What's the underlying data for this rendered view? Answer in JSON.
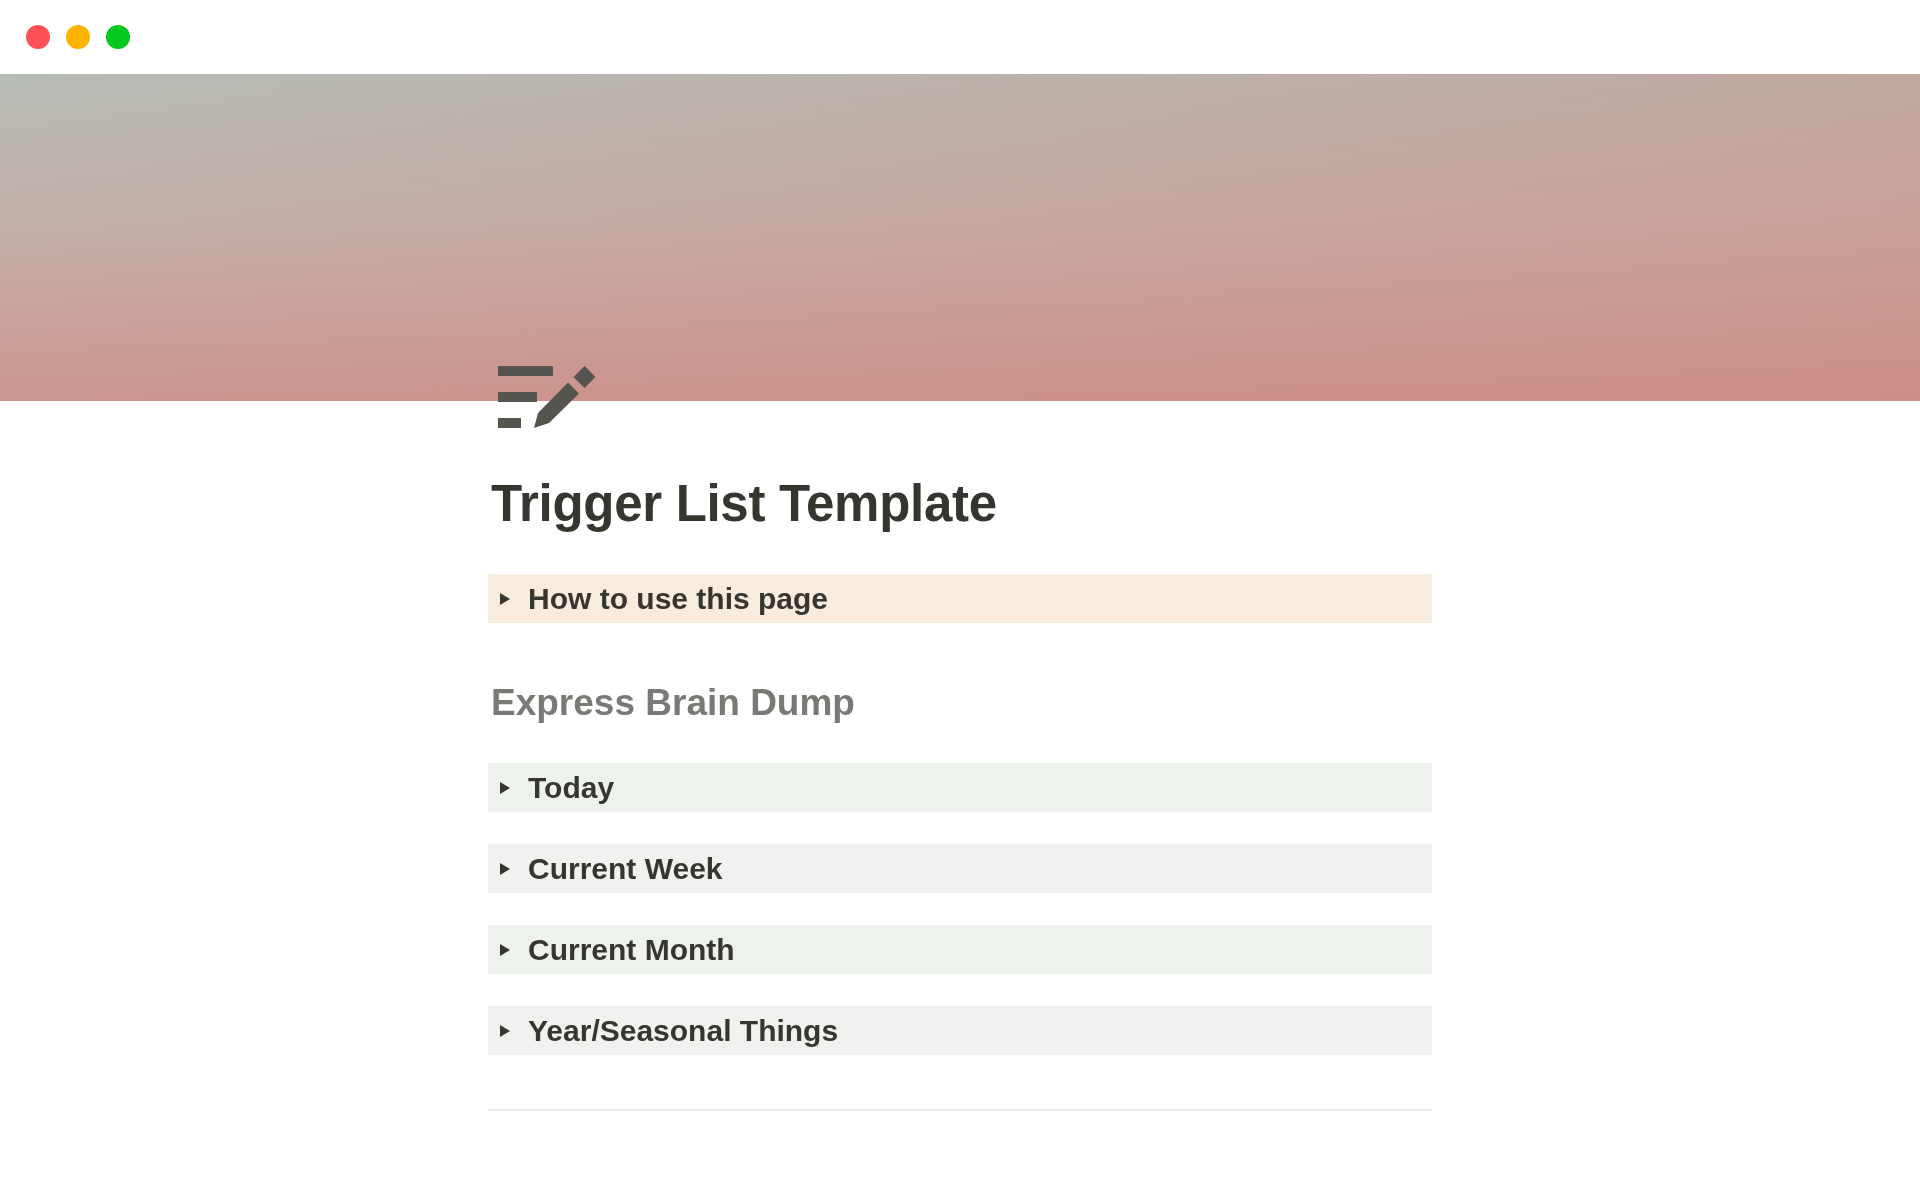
{
  "page": {
    "title": "Trigger List Template",
    "blocks": [
      {
        "kind": "toggle",
        "label": "How to use this page",
        "expanded": false,
        "color": "#f8ecdf"
      },
      {
        "kind": "heading",
        "text": "Express Brain Dump"
      },
      {
        "kind": "toggle",
        "label": "Today",
        "expanded": false,
        "color": "#edf3ec"
      },
      {
        "kind": "toggle",
        "label": "Current Week",
        "expanded": false,
        "color": "#f1f1ef"
      },
      {
        "kind": "toggle",
        "label": "Current Month",
        "expanded": false,
        "color": "#edf3ec"
      },
      {
        "kind": "toggle",
        "label": "Year/Seasonal Things",
        "expanded": false,
        "color": "#f1f1ef"
      },
      {
        "kind": "divider"
      }
    ]
  }
}
